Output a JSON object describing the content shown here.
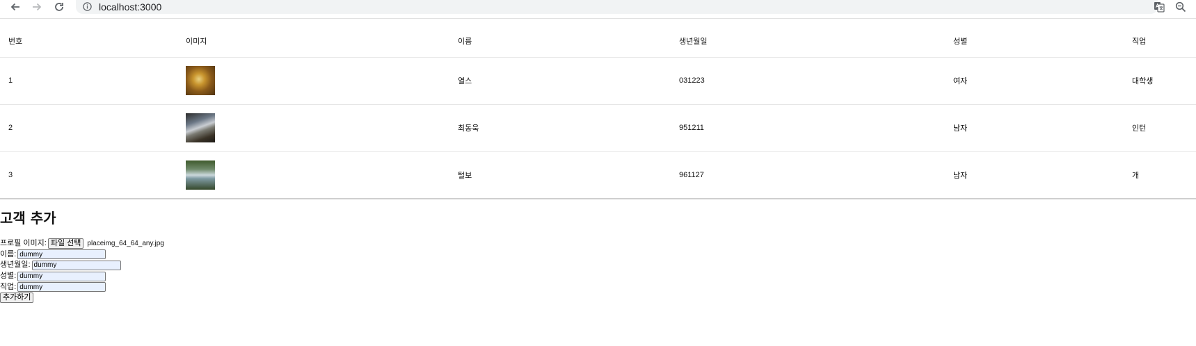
{
  "browser": {
    "url": "localhost:3000",
    "back_icon": "arrow-left-icon",
    "forward_icon": "arrow-right-icon",
    "reload_icon": "reload-icon",
    "info_icon": "info-icon",
    "translate_icon": "translate-icon",
    "zoom_icon": "zoom-out-icon"
  },
  "table": {
    "headers": [
      "번호",
      "이미지",
      "이름",
      "생년월일",
      "성별",
      "직업"
    ],
    "rows": [
      {
        "id": "1",
        "image": "profile-thumbnail",
        "name": "열스",
        "birthday": "031223",
        "gender": "여자",
        "job": "대학생"
      },
      {
        "id": "2",
        "image": "profile-thumbnail",
        "name": "최동욱",
        "birthday": "951211",
        "gender": "남자",
        "job": "인턴"
      },
      {
        "id": "3",
        "image": "profile-thumbnail",
        "name": "털보",
        "birthday": "961127",
        "gender": "남자",
        "job": "개"
      }
    ]
  },
  "form": {
    "title": "고객 추가",
    "profile_label": "프로필 이미지:",
    "file_button": "파일 선택",
    "file_name": "placeimg_64_64_any.jpg",
    "name_label": "이름:",
    "name_value": "dummy",
    "birthday_label": "생년월일:",
    "birthday_value": "dummy",
    "gender_label": "성별:",
    "gender_value": "dummy",
    "job_label": "직업:",
    "job_value": "dummy",
    "submit_label": "추가하기"
  },
  "colors": {
    "omnibox_bg": "#f1f3f4",
    "autofill_bg": "#e8f0fe"
  }
}
